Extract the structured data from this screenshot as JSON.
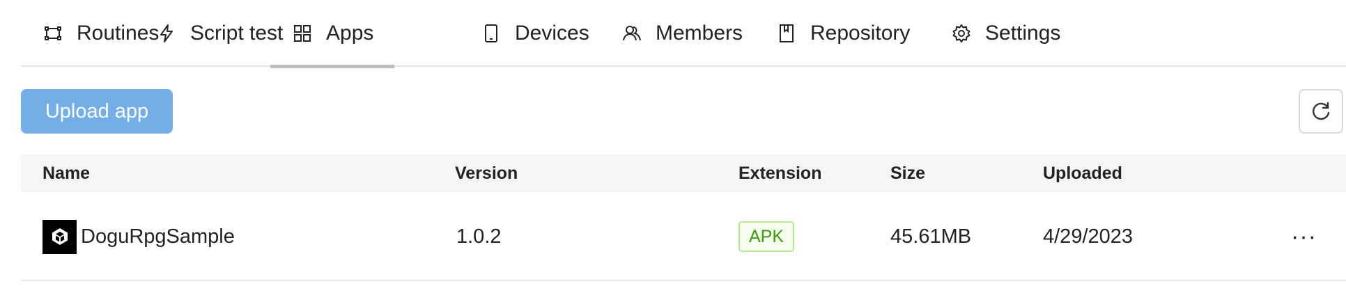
{
  "tabs": [
    {
      "label": "Routines",
      "icon": "routine-icon"
    },
    {
      "label": "Script test",
      "icon": "lightning-icon"
    },
    {
      "label": "Apps",
      "icon": "grid-icon"
    },
    {
      "label": "Devices",
      "icon": "mobile-icon"
    },
    {
      "label": "Members",
      "icon": "members-icon"
    },
    {
      "label": "Repository",
      "icon": "book-icon"
    },
    {
      "label": "Settings",
      "icon": "gear-icon"
    }
  ],
  "active_tab": "Apps",
  "toolbar": {
    "upload_label": "Upload app",
    "refresh_icon": "refresh-icon"
  },
  "table": {
    "columns": [
      "Name",
      "Version",
      "Extension",
      "Size",
      "Uploaded"
    ],
    "rows": [
      {
        "name": "DoguRpgSample",
        "version": "1.0.2",
        "extension": "APK",
        "size": "45.61MB",
        "uploaded": "4/29/2023",
        "logo_icon": "unity-icon",
        "more_label": "···"
      }
    ]
  },
  "colors": {
    "primary_button": "#73aee9",
    "badge_border": "#b7eb8f",
    "badge_text": "#389e0d",
    "header_bg": "#f4f5f7"
  }
}
